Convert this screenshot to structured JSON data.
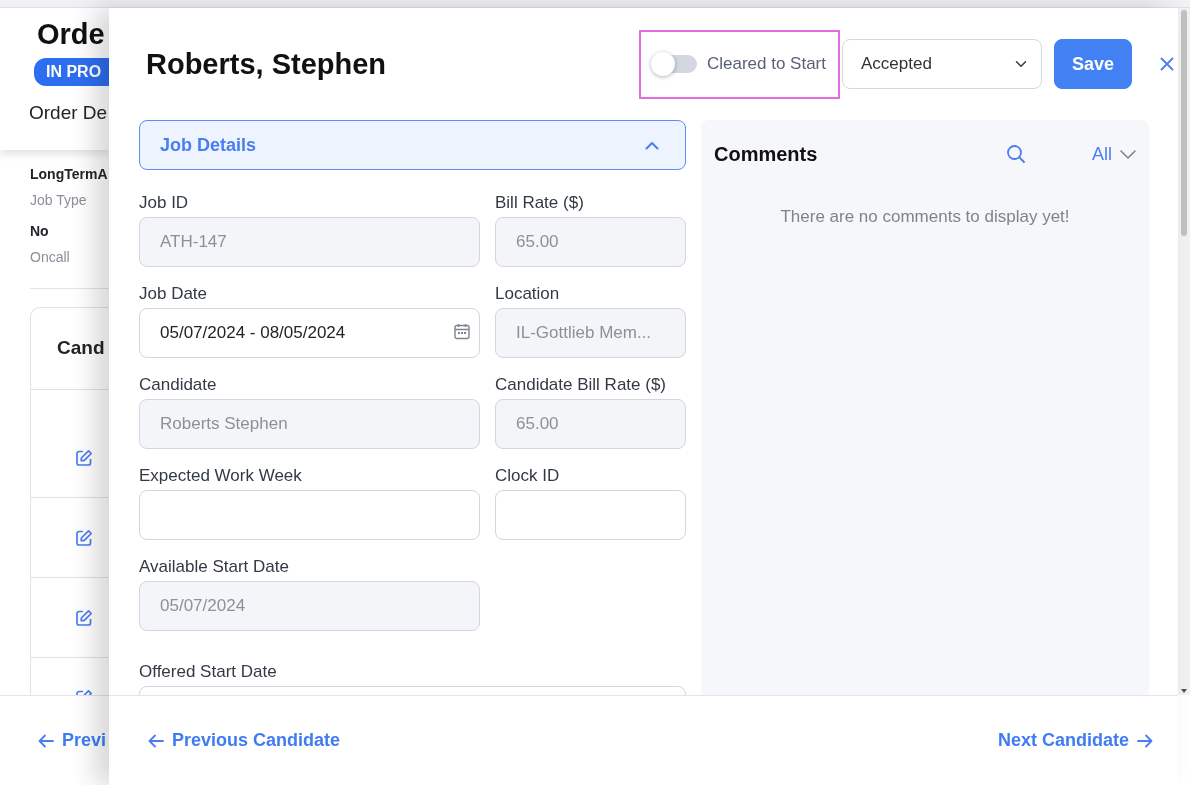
{
  "background_page": {
    "title": "Orde",
    "status_badge": "IN PRO",
    "tab": "Order De",
    "details": [
      {
        "value": "LongTermA",
        "label": "Job Type"
      },
      {
        "value": "No",
        "label": "Oncall"
      }
    ],
    "table_heading": "Cand",
    "footer_link": "Previ"
  },
  "modal": {
    "title": "Roberts, Stephen",
    "cleared_to_start": {
      "label": "Cleared to Start",
      "on": false
    },
    "status_select": {
      "value": "Accepted"
    },
    "save_button": "Save",
    "section": {
      "title": "Job Details",
      "expanded": true
    },
    "field_rows": [
      [
        {
          "label": "Job ID",
          "value": "ATH-147",
          "disabled": true,
          "kind": "text"
        },
        {
          "label": "Bill Rate ($)",
          "value": "65.00",
          "disabled": true,
          "kind": "text"
        }
      ],
      [
        {
          "label": "Job Date",
          "value": "05/07/2024 - 08/05/2024",
          "disabled": false,
          "kind": "date"
        },
        {
          "label": "Location",
          "value": "IL-Gottlieb Mem...",
          "disabled": true,
          "kind": "text"
        }
      ],
      [
        {
          "label": "Candidate",
          "value": "Roberts Stephen",
          "disabled": true,
          "kind": "text"
        },
        {
          "label": "Candidate Bill Rate ($)",
          "value": "65.00",
          "disabled": true,
          "kind": "text"
        }
      ],
      [
        {
          "label": "Expected Work Week",
          "disabled": false,
          "kind": "text"
        },
        {
          "label": "Clock ID",
          "disabled": false,
          "kind": "text"
        }
      ],
      [
        {
          "label": "Available Start Date",
          "value": "05/07/2024",
          "disabled": true,
          "kind": "text"
        }
      ]
    ],
    "offered_start_date": {
      "label": "Offered Start Date"
    },
    "comments": {
      "title": "Comments",
      "filter": "All",
      "empty_message": "There are no comments to display yet!"
    },
    "footer": {
      "previous": "Previous Candidate",
      "next": "Next Candidate"
    }
  }
}
